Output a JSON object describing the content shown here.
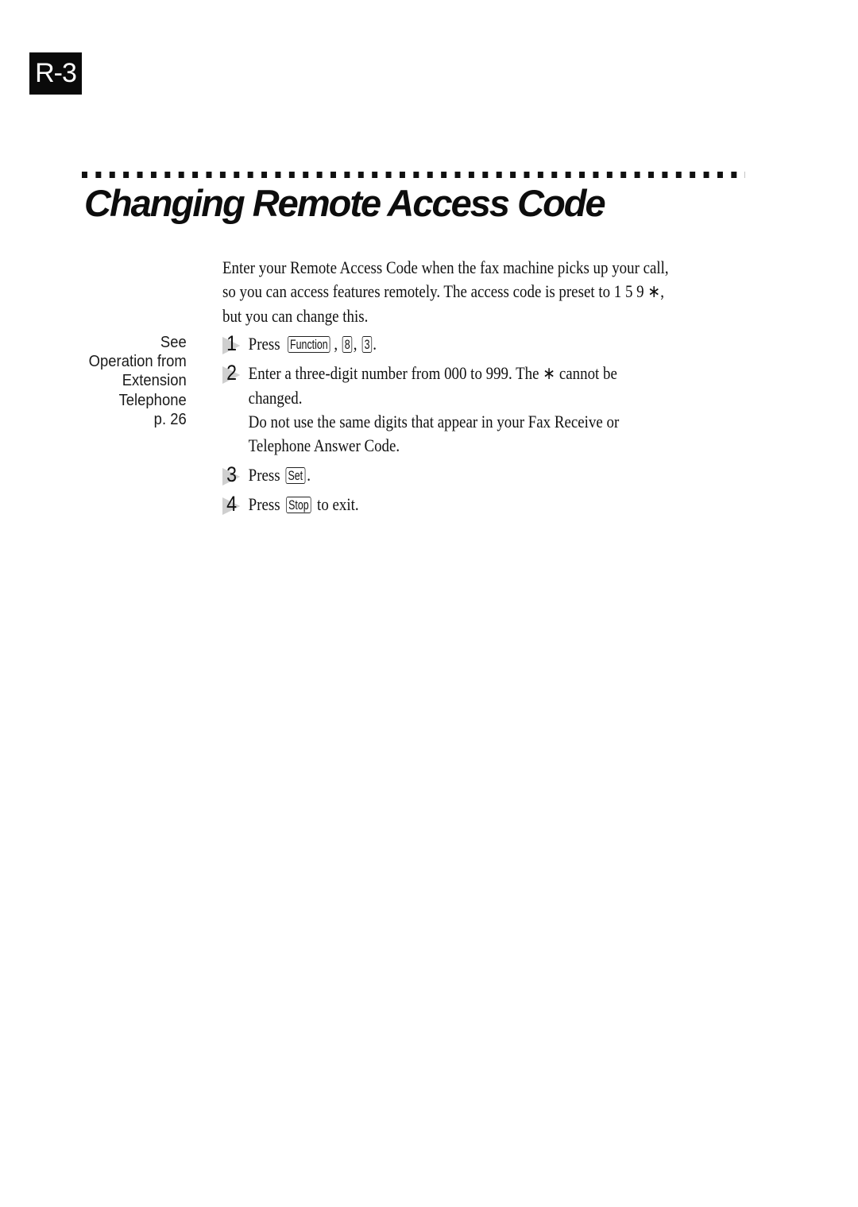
{
  "page": {
    "section_tab": "R-3",
    "title": "Changing Remote Access Code"
  },
  "sidebar_note": {
    "lines": [
      "See",
      "Operation from",
      "Extension",
      "Telephone",
      "p. 26"
    ]
  },
  "intro": {
    "line1": "Enter your Remote Access Code when the fax machine picks up your call,",
    "line2_before": "so you can access features remotely.  The access code is preset to 1 5 9 ",
    "star_symbol": "∗",
    "line2_after": ",",
    "line3": "but you can change this."
  },
  "steps": [
    {
      "number": "1",
      "text_before": "Press ",
      "keys": [
        "Function",
        "8",
        "3"
      ],
      "separator": ", ",
      "text_after": "."
    },
    {
      "number": "2",
      "line1_before": "Enter a three-digit number from 000 to 999. The ",
      "star_symbol": "∗",
      "line1_after": " cannot be",
      "line2": "changed.",
      "line3": "Do not use the same digits that appear in your Fax Receive or",
      "line4": "Telephone Answer Code."
    },
    {
      "number": "3",
      "text_before": "Press ",
      "key": "Set",
      "text_after": "."
    },
    {
      "number": "4",
      "text_before": "Press ",
      "key": "Stop",
      "text_after": " to exit."
    }
  ],
  "icons": {
    "step_marker": "arrow-step-marker-icon",
    "star": "star-key-icon"
  }
}
